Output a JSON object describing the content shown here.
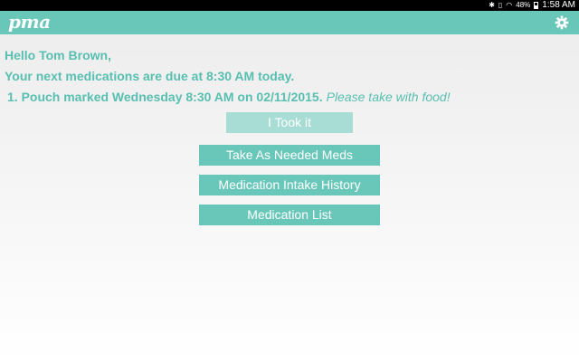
{
  "status_bar": {
    "battery_percent": "48%",
    "time": "1:58 AM",
    "icons": [
      "bluetooth-icon",
      "vibrate-icon",
      "wifi-icon",
      "battery-icon"
    ]
  },
  "app_bar": {
    "logo": "pma",
    "settings_icon": "gear-icon",
    "color": "#69c7b9"
  },
  "main": {
    "greeting": "Hello Tom Brown,",
    "next_due": "Your next medications are due at 8:30 AM today.",
    "pouch": {
      "text": "1. Pouch marked Wednesday 8:30 AM on 02/11/2015.",
      "note": "Please take with food!"
    },
    "took_it_label": "I Took it",
    "buttons": {
      "as_needed": "Take As Needed Meds",
      "history": "Medication Intake History",
      "list": "Medication List"
    }
  }
}
